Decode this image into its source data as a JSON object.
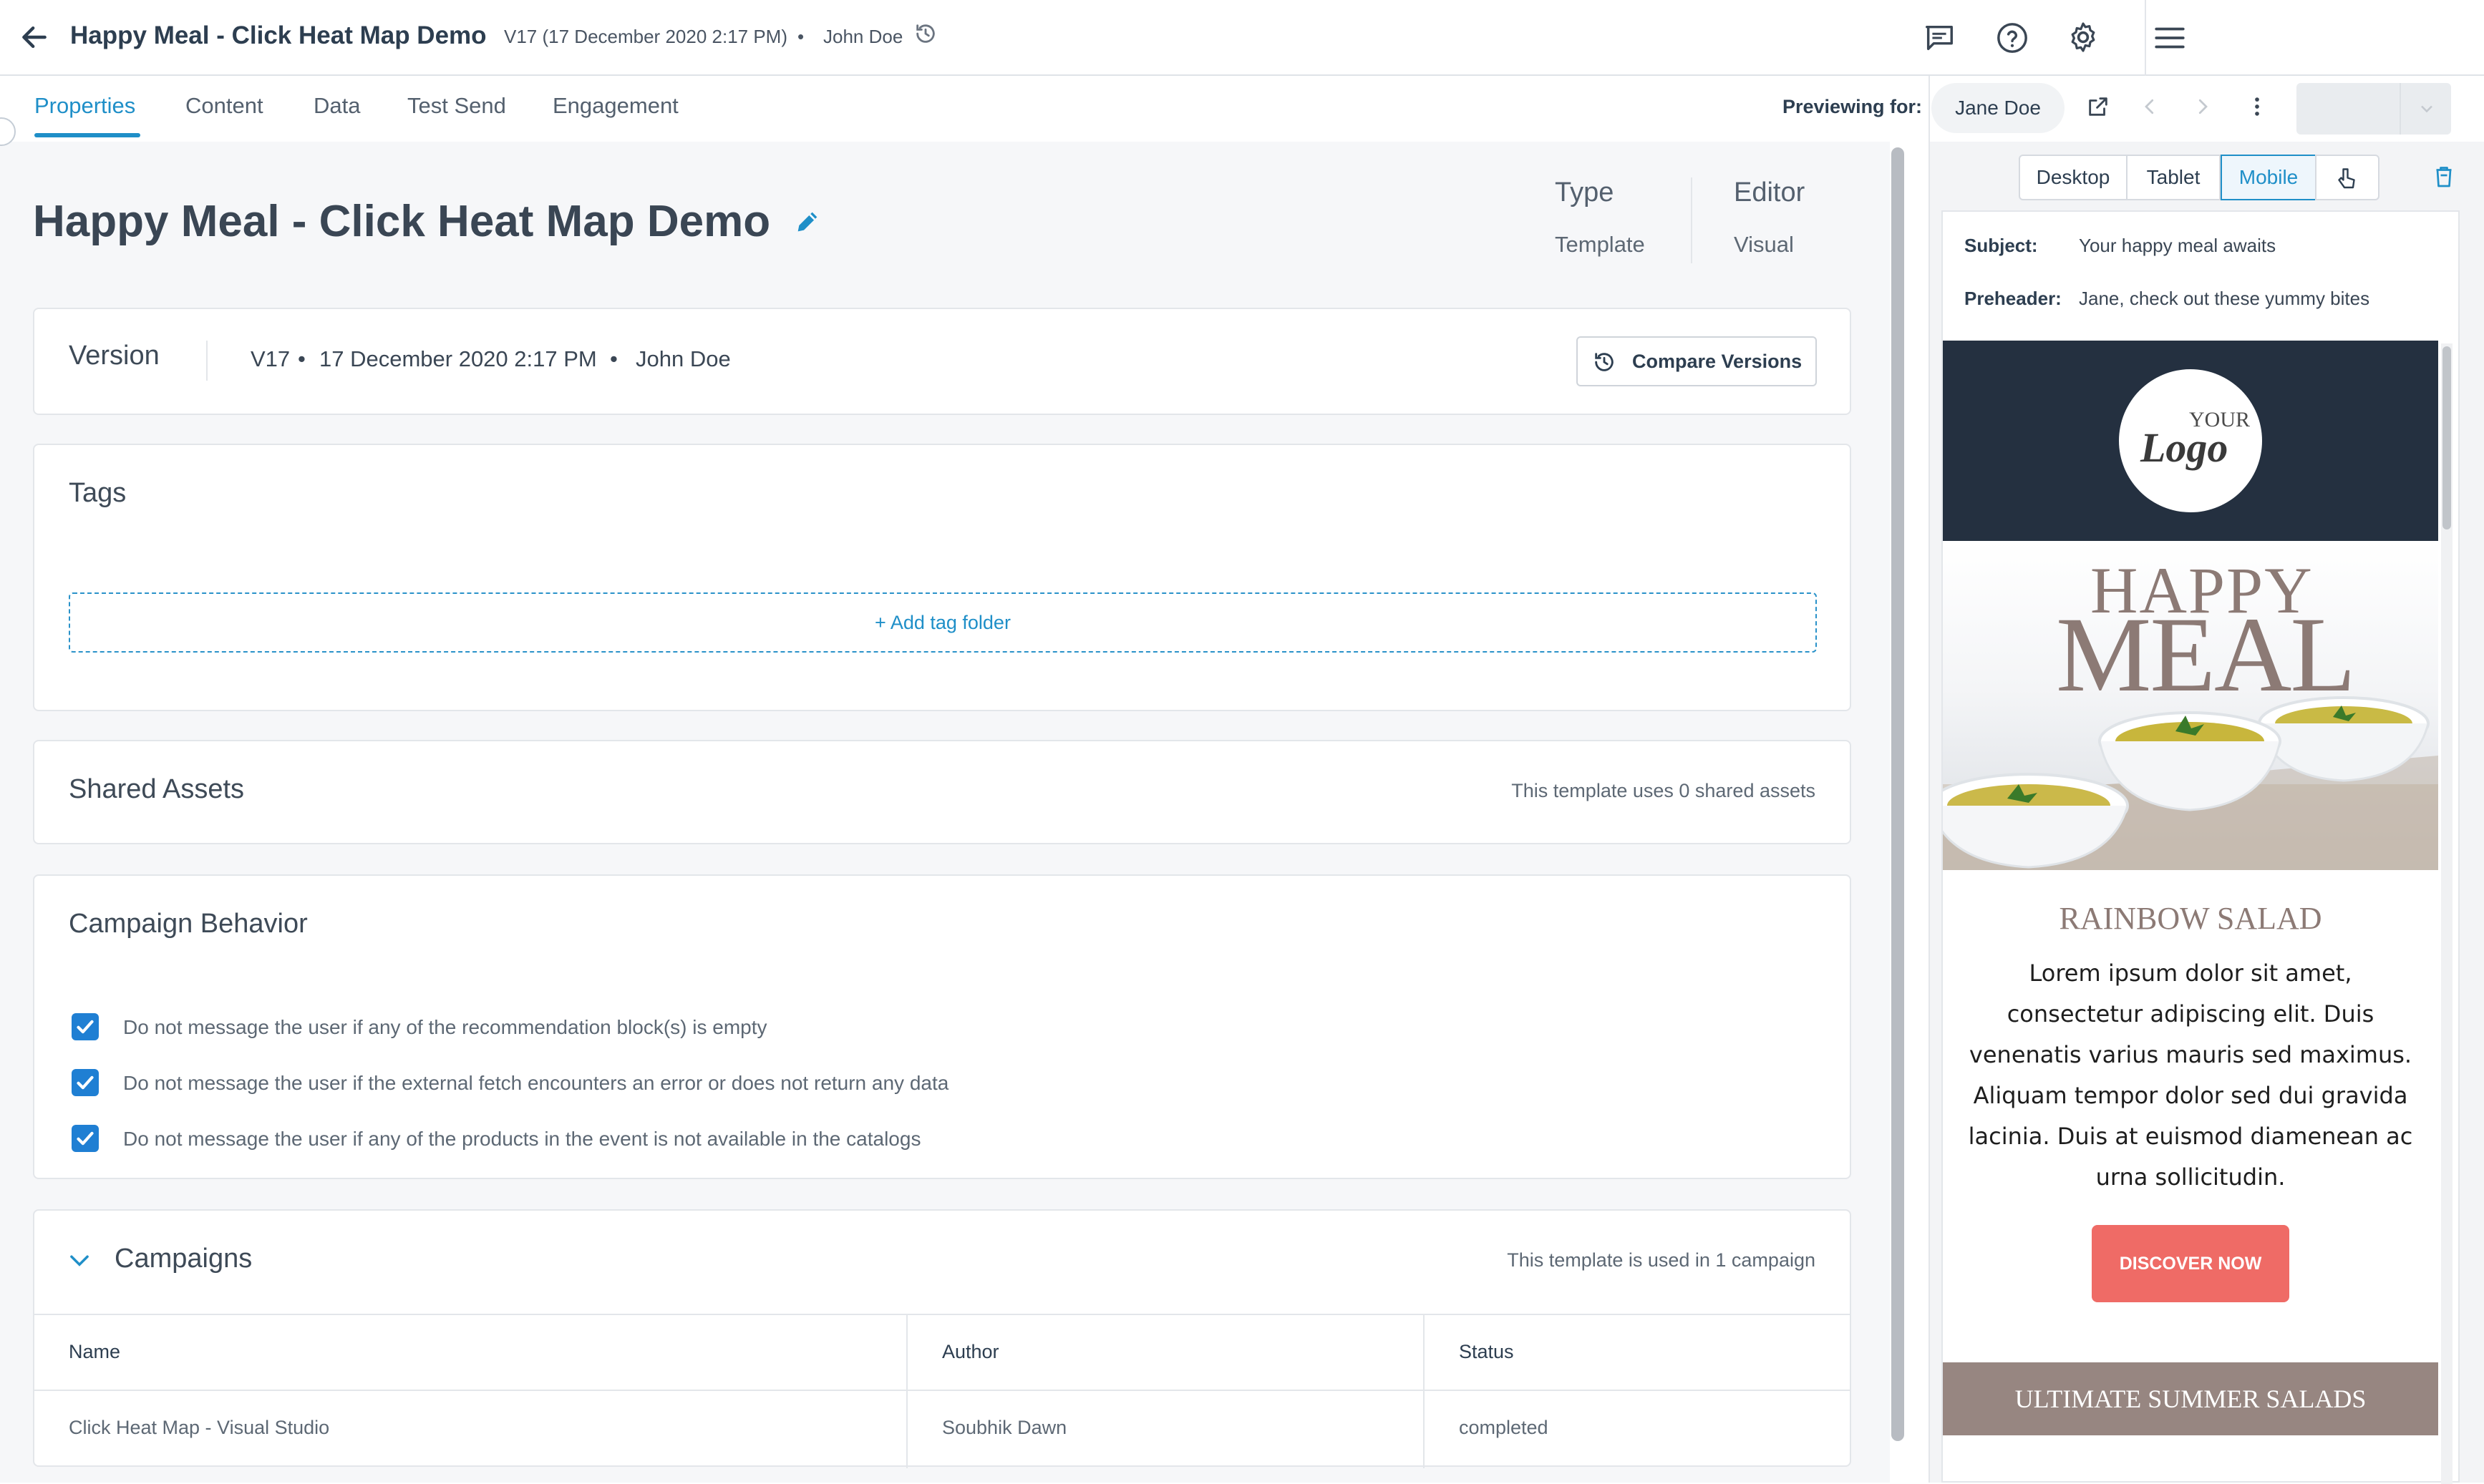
{
  "header": {
    "title": "Happy Meal - Click Heat Map Demo",
    "version_meta": "V17 (17 December 2020 2:17 PM)",
    "separator": "•",
    "author": "John Doe"
  },
  "tabs": [
    {
      "label": "Properties",
      "active": true
    },
    {
      "label": "Content"
    },
    {
      "label": "Data"
    },
    {
      "label": "Test Send"
    },
    {
      "label": "Engagement"
    }
  ],
  "preview_bar": {
    "previewing_for_label": "Previewing for:",
    "user": "Jane Doe"
  },
  "page": {
    "title": "Happy Meal - Click Heat Map Demo",
    "type_label": "Type",
    "type_value": "Template",
    "editor_label": "Editor",
    "editor_value": "Visual"
  },
  "version_card": {
    "label": "Version",
    "version": "V17",
    "date": "17 December 2020 2:17 PM",
    "author": "John Doe",
    "bullet": "•",
    "compare_button": "Compare Versions"
  },
  "tags_card": {
    "title": "Tags",
    "add_button": "+ Add tag folder"
  },
  "shared_assets_card": {
    "title": "Shared Assets",
    "summary": "This template uses 0 shared assets"
  },
  "campaign_behavior": {
    "title": "Campaign Behavior",
    "options": [
      {
        "label": "Do not message the user if any of the recommendation block(s) is empty",
        "checked": true
      },
      {
        "label": "Do not message the user if the external fetch encounters an error or does not return any data",
        "checked": true
      },
      {
        "label": "Do not message the user if any of the products in the event is not available in the catalogs",
        "checked": true
      }
    ]
  },
  "campaigns": {
    "title": "Campaigns",
    "summary": "This template is used in 1 campaign",
    "columns": [
      "Name",
      "Author",
      "Status"
    ],
    "rows": [
      {
        "name": "Click Heat Map - Visual Studio",
        "author": "Soubhik Dawn",
        "status": "completed"
      }
    ]
  },
  "preview": {
    "devices": [
      {
        "label": "Desktop"
      },
      {
        "label": "Tablet"
      },
      {
        "label": "Mobile",
        "active": true
      }
    ],
    "subject_label": "Subject:",
    "subject": "Your happy meal awaits",
    "preheader_label": "Preheader:",
    "preheader": "Jane, check out these yummy bites",
    "logo_top": "YOUR",
    "logo_bottom": "Logo",
    "hero_line1": "HAPPY",
    "hero_line2": "MEAL",
    "section_title": "RAINBOW SALAD",
    "body_text": "Lorem ipsum dolor sit amet, consectetur adipiscing elit. Duis venenatis varius mauris sed maximus. Aliquam tempor dolor sed dui gravida lacinia. Duis at euismod diamenean ac urna sollicitudin.",
    "cta": "DISCOVER NOW",
    "banner": "ULTIMATE SUMMER SALADS"
  },
  "colors": {
    "accent": "#1f8fc8",
    "checkbox": "#1f7fd3",
    "email_header": "#243040",
    "cta": "#ef6b66",
    "banner": "#978681",
    "hero_text": "#8c7a75"
  },
  "icons": [
    "arrow-left-icon",
    "history-icon",
    "comment-icon",
    "help-icon",
    "gear-icon",
    "menu-icon",
    "external-link-icon",
    "chevron-left-icon",
    "chevron-right-icon",
    "more-vertical-icon",
    "pencil-icon",
    "chevron-down-icon",
    "pointer-icon",
    "trash-icon"
  ]
}
